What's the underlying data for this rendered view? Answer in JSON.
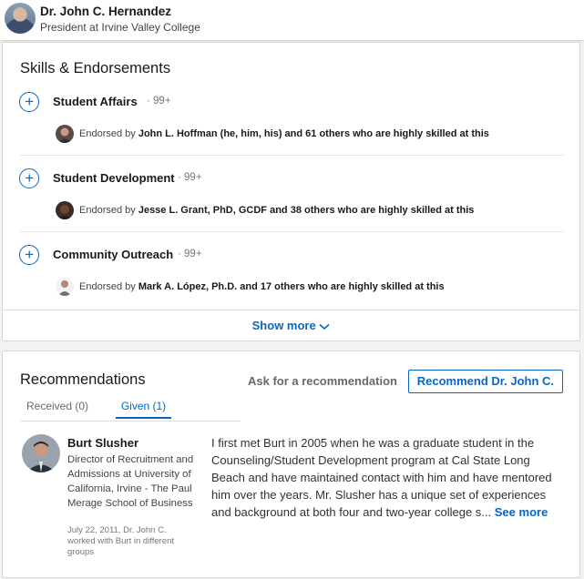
{
  "header": {
    "name": "Dr. John C. Hernandez",
    "headline": "President at Irvine Valley College"
  },
  "skills": {
    "title": "Skills & Endorsements",
    "items": [
      {
        "name": "Student Affairs",
        "count": "· 99+",
        "endorsed_prefix": "Endorsed by ",
        "endorser": "John L. Hoffman (he, him, his) and 61 others who are highly skilled at this"
      },
      {
        "name": "Student Development",
        "count": "· 99+",
        "endorsed_prefix": "Endorsed by ",
        "endorser": "Jesse L. Grant, PhD, GCDF and 38 others who are highly skilled at this"
      },
      {
        "name": "Community Outreach",
        "count": "· 99+",
        "endorsed_prefix": "Endorsed by ",
        "endorser": "Mark A. López, Ph.D. and 17 others who are highly skilled at this"
      }
    ],
    "show_more": "Show more",
    "show_more_icon": "chevron-down-icon"
  },
  "recommendations": {
    "title": "Recommendations",
    "ask_label": "Ask for a recommendation",
    "recommend_label": "Recommend Dr. John C.",
    "tabs": [
      {
        "label": "Received (0)",
        "active": false
      },
      {
        "label": "Given (1)",
        "active": true
      }
    ],
    "item": {
      "name": "Burt Slusher",
      "title": "Director of Recruitment and Admissions at University of California, Irvine - The Paul Merage School of Business",
      "meta": "July 22, 2011, Dr. John C. worked with Burt in different groups",
      "text": "I first met Burt in 2005 when he was a graduate student in the Counseling/Student Development program at Cal State Long Beach and have maintained contact with him and have mentored him over the years. Mr. Slusher has a unique set of experiences and background at both four and two-year college s...",
      "see_more": "See more"
    }
  },
  "colors": {
    "accent": "#0a66c2",
    "background": "#f3f2ef"
  }
}
